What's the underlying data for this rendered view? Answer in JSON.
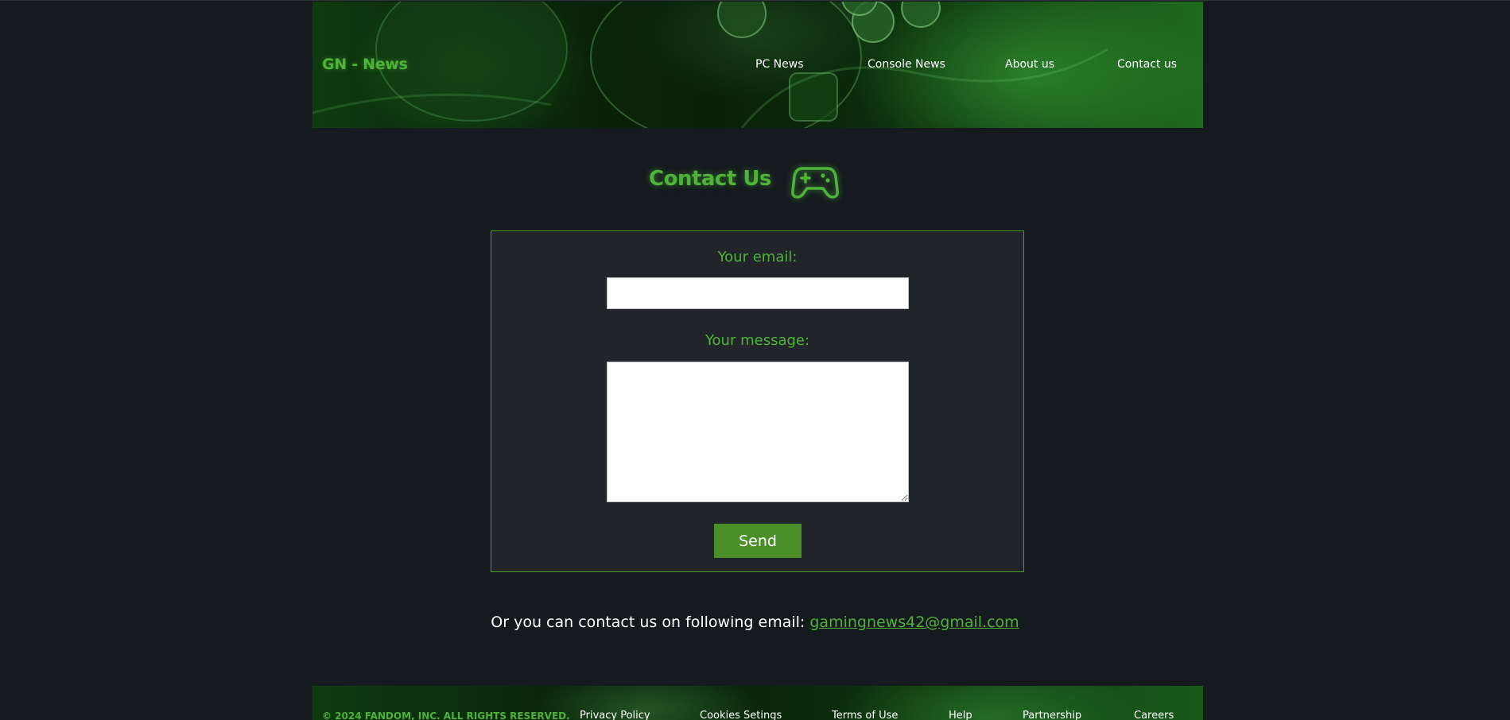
{
  "header": {
    "brand": "GN - News",
    "nav": [
      {
        "label": "PC News"
      },
      {
        "label": "Console News"
      },
      {
        "label": "About us"
      },
      {
        "label": "Contact us"
      }
    ]
  },
  "main": {
    "title": "Contact Us",
    "title_icon": "gamepad-icon",
    "form": {
      "email_label": "Your email:",
      "email_value": "",
      "message_label": "Your message:",
      "message_value": "",
      "send_label": "Send"
    },
    "alt_contact_text": "Or you can contact us on following email:",
    "alt_contact_email": "gamingnews42@gmail.com"
  },
  "footer": {
    "copyright": "© 2024 FANDOM, INC. ALL RIGHTS RESERVED.",
    "links": [
      {
        "label": "Privacy Policy"
      },
      {
        "label": "Cookies Setings"
      },
      {
        "label": "Terms of Use"
      },
      {
        "label": "Help"
      },
      {
        "label": "Partnership"
      },
      {
        "label": "Careers"
      }
    ]
  },
  "colors": {
    "background": "#151a1e",
    "accent": "#4fb33a",
    "form_background": "#212529",
    "button": "#4a8f28"
  }
}
